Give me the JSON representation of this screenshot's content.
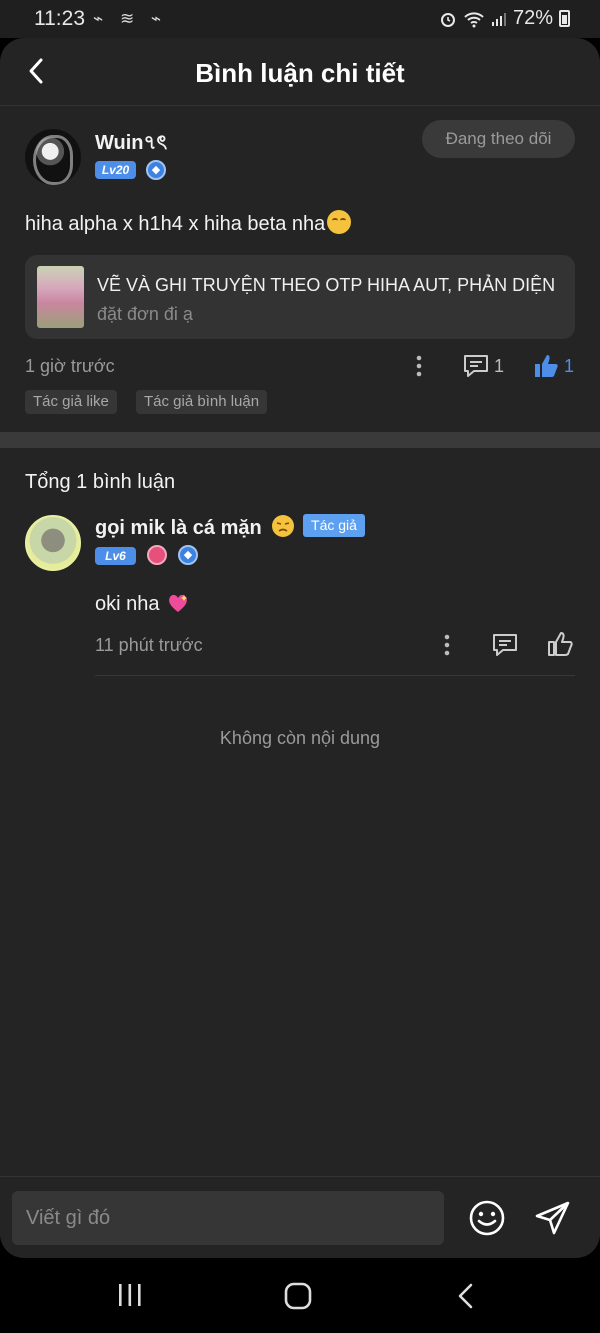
{
  "status_bar": {
    "time": "11:23",
    "battery": "72%"
  },
  "header": {
    "title": "Bình luận chi tiết"
  },
  "post": {
    "username": "Wuin৭ৎ",
    "level": "Lv20",
    "follow_label": "Đang theo dõi",
    "text": "hiha alpha x h1h4 x hiha beta nha",
    "story": {
      "title": "VẼ VÀ GHI TRUYỆN THEO OTP HIHA AUT, PHẢN DIỆN",
      "subtitle": "đặt đơn đi ạ"
    },
    "time": "1 giờ trước",
    "comment_count": "1",
    "like_count": "1",
    "tags": [
      "Tác giả like",
      "Tác giả bình luận"
    ],
    "colors": {
      "like_active": "#4c8ee8"
    }
  },
  "comments_section": {
    "total_label": "Tổng 1 bình luận",
    "comments": [
      {
        "username": "gọi mik là cá mặn",
        "author_tag": "Tác giả",
        "level": "Lv6",
        "text": "oki nha",
        "time": "11 phút trước"
      }
    ],
    "end_label": "Không còn nội dung"
  },
  "composer": {
    "placeholder": "Viết gì đó"
  },
  "icons": [
    "back-icon",
    "more-icon",
    "comment-icon",
    "thumbs-up-icon",
    "emoji-icon",
    "send-icon",
    "recents-icon",
    "home-icon",
    "nav-back-icon"
  ]
}
